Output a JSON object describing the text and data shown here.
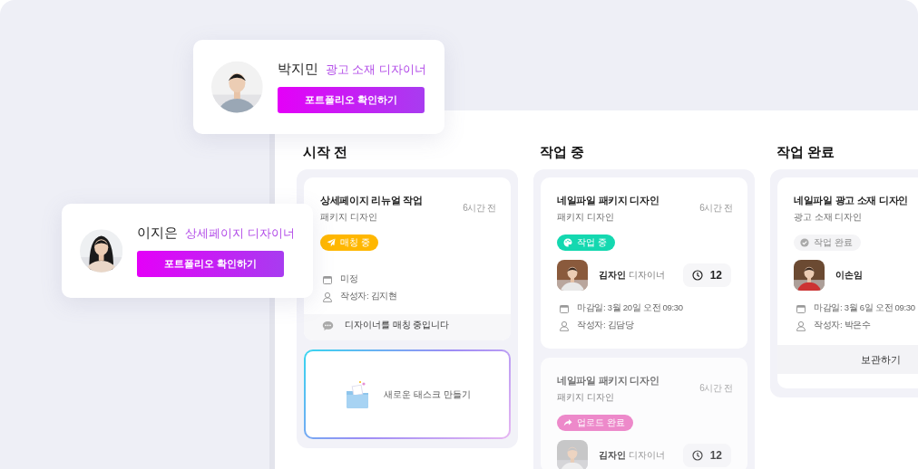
{
  "profiles": [
    {
      "name": "박지민",
      "role": "광고 소재 디자이너",
      "button": "포트폴리오 확인하기"
    },
    {
      "name": "이지은",
      "role": "상세페이지 디자이너",
      "button": "포트폴리오 확인하기"
    }
  ],
  "columns": [
    {
      "title": "시작 전",
      "cards": [
        {
          "title": "상세페이지 리뉴얼 작업",
          "category": "패키지 디자인",
          "time": "6시간 전",
          "status": {
            "kind": "matching",
            "label": "매칭 중"
          },
          "deadline": "미정",
          "author": "작성자: 김지현",
          "footer": {
            "kind": "message",
            "text": "디자이너를 매칭 중입니다"
          },
          "dimmed": false
        }
      ],
      "create": "새로운 태스크 만들기"
    },
    {
      "title": "작업 중",
      "cards": [
        {
          "title": "네일파일 패키지 디자인",
          "category": "패키지 디자인",
          "time": "6시간 전",
          "status": {
            "kind": "working",
            "label": "작업 중"
          },
          "designer": {
            "name": "김자인",
            "role": "디자이너",
            "timer": "12"
          },
          "deadline": "마감일: 3월 20일 오전 09:30",
          "author": "작성자: 김담당",
          "dimmed": false
        },
        {
          "title": "네일파일 패키지 디자인",
          "category": "패키지 디자인",
          "time": "6시간 전",
          "status": {
            "kind": "uploaded",
            "label": "업로드 완료"
          },
          "designer": {
            "name": "김자인",
            "role": "디자이너",
            "timer": "12"
          },
          "dimmed": true
        }
      ]
    },
    {
      "title": "작업 완료",
      "cards": [
        {
          "title": "네일파일 광고 소재 디자인",
          "category": "광고 소재 디자인",
          "status": {
            "kind": "done",
            "label": "작업 완료"
          },
          "designer": {
            "name": "이손임"
          },
          "deadline": "마감일: 3월 6일 오전 09:30",
          "author": "작성자: 박은수",
          "footer": {
            "kind": "button",
            "text": "보관하기"
          },
          "dimmed": false
        }
      ]
    }
  ]
}
